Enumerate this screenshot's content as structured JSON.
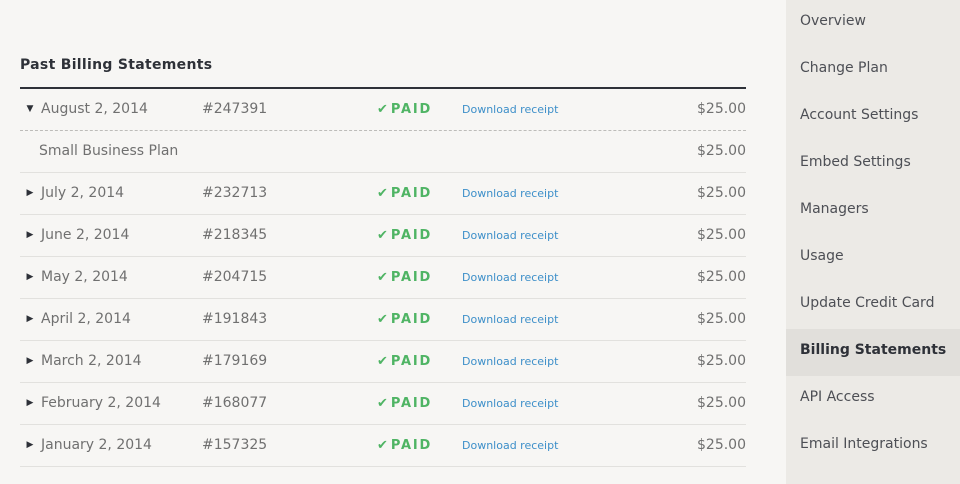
{
  "section_title": "Past Billing Statements",
  "expanded_detail": {
    "plan": "Small Business Plan",
    "amount": "$25.00"
  },
  "statements": [
    {
      "date": "August 2, 2014",
      "invoice": "#247391",
      "status": "PAID",
      "receipt": "Download receipt",
      "amount": "$25.00",
      "expanded": true
    },
    {
      "date": "July 2, 2014",
      "invoice": "#232713",
      "status": "PAID",
      "receipt": "Download receipt",
      "amount": "$25.00"
    },
    {
      "date": "June 2, 2014",
      "invoice": "#218345",
      "status": "PAID",
      "receipt": "Download receipt",
      "amount": "$25.00"
    },
    {
      "date": "May 2, 2014",
      "invoice": "#204715",
      "status": "PAID",
      "receipt": "Download receipt",
      "amount": "$25.00"
    },
    {
      "date": "April 2, 2014",
      "invoice": "#191843",
      "status": "PAID",
      "receipt": "Download receipt",
      "amount": "$25.00"
    },
    {
      "date": "March 2, 2014",
      "invoice": "#179169",
      "status": "PAID",
      "receipt": "Download receipt",
      "amount": "$25.00"
    },
    {
      "date": "February 2, 2014",
      "invoice": "#168077",
      "status": "PAID",
      "receipt": "Download receipt",
      "amount": "$25.00"
    },
    {
      "date": "January 2, 2014",
      "invoice": "#157325",
      "status": "PAID",
      "receipt": "Download receipt",
      "amount": "$25.00"
    }
  ],
  "sidebar": {
    "items": [
      {
        "label": "Overview"
      },
      {
        "label": "Change Plan"
      },
      {
        "label": "Account Settings"
      },
      {
        "label": "Embed Settings"
      },
      {
        "label": "Managers"
      },
      {
        "label": "Usage"
      },
      {
        "label": "Update Credit Card"
      },
      {
        "label": "Billing Statements",
        "active": true
      },
      {
        "label": "API Access"
      },
      {
        "label": "Email Integrations"
      }
    ]
  },
  "icons": {
    "expanded": "triangle-down-icon",
    "collapsed": "triangle-right-icon",
    "paid": "check-icon"
  },
  "colors": {
    "paid_green": "#4fb464",
    "link_blue": "#3d8fc9",
    "title_dark": "#2e3138",
    "sidebar_bg": "#eceae6",
    "sidebar_active_bg": "#e1dfdb"
  }
}
